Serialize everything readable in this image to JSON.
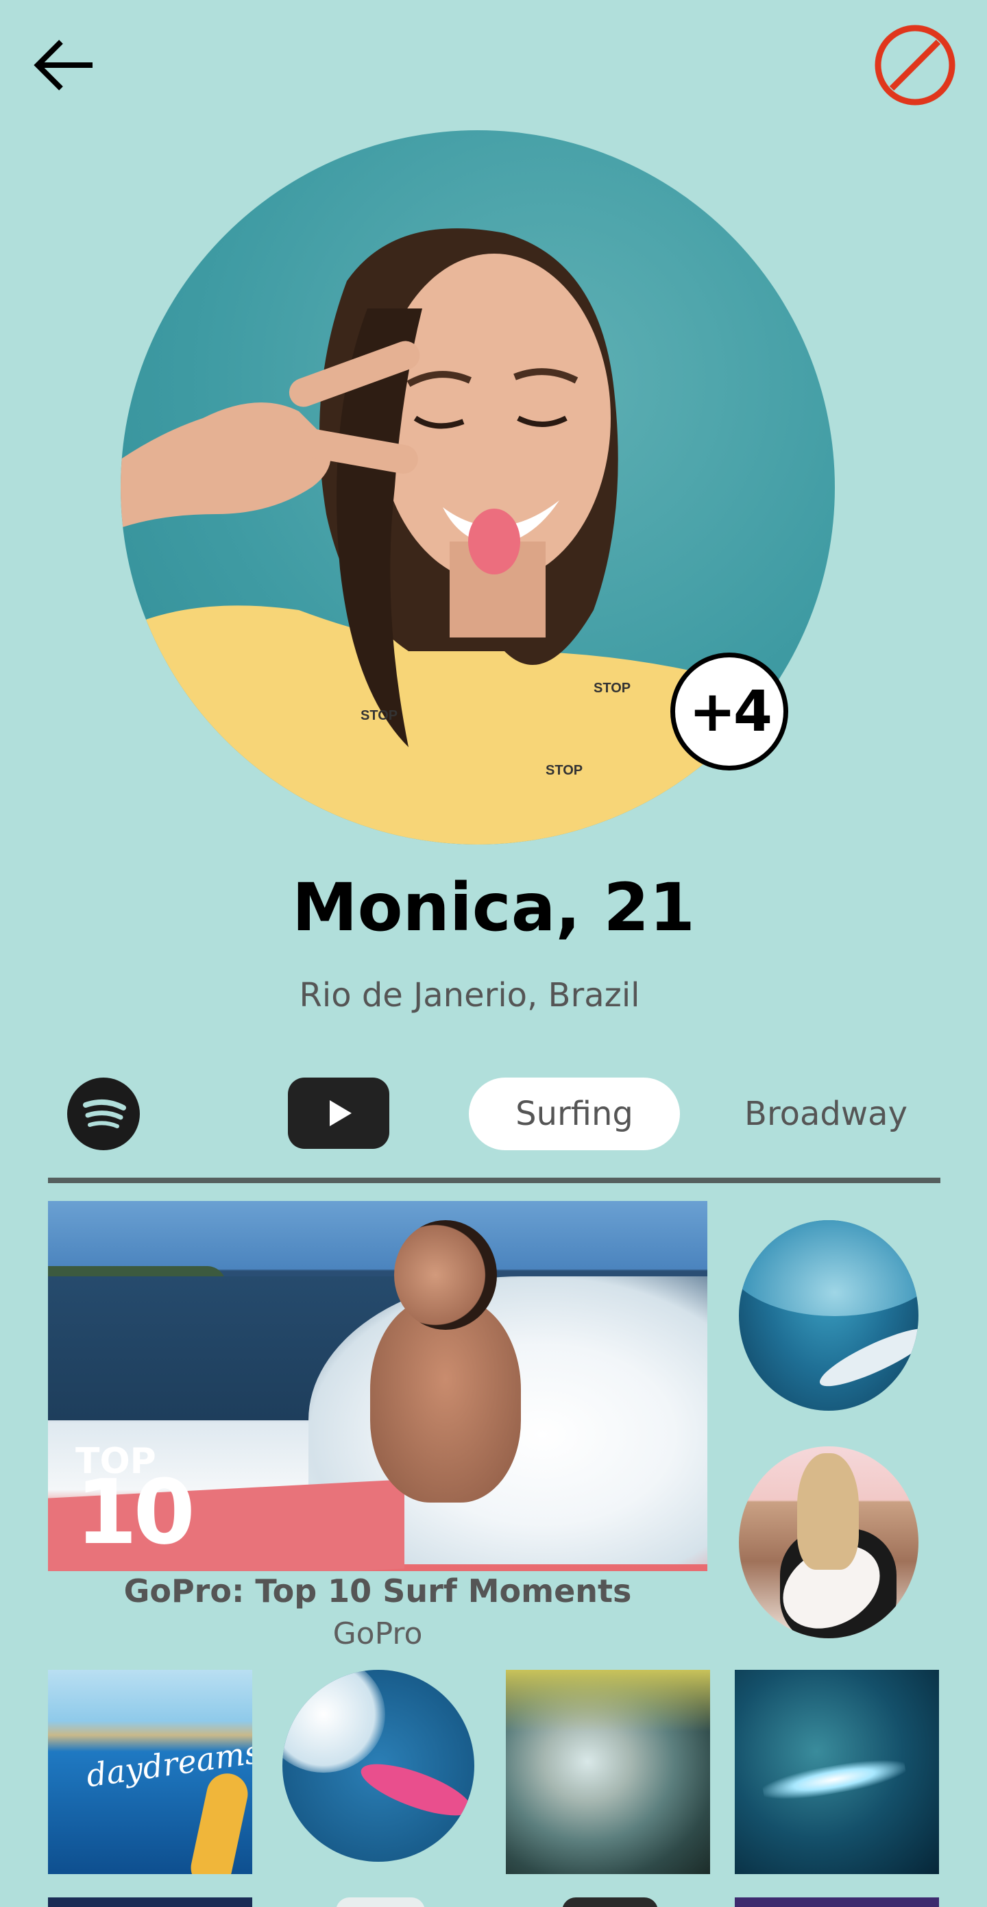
{
  "header": {
    "back_icon": "arrow-left-icon",
    "block_icon": "block-icon",
    "block_color": "#e0361c"
  },
  "profile": {
    "more_photos_label": "+4",
    "name_age": "Monica, 21",
    "location": "Rio de Janerio, Brazil"
  },
  "tabs": {
    "spotify_icon": "spotify-icon",
    "youtube_icon": "youtube-play-icon",
    "surfing_label": "Surfing",
    "broadway_label": "Broadway",
    "active": "Surfing"
  },
  "featured_video": {
    "thumbnail_overlay_top": "TOP",
    "thumbnail_overlay_number": "10",
    "title": "GoPro: Top 10 Surf Moments",
    "channel": "GoPro"
  },
  "bottom_row": {
    "thumb1_text": "daydreams"
  },
  "colors": {
    "background": "#b1dfdb",
    "divider": "#555f5e"
  }
}
